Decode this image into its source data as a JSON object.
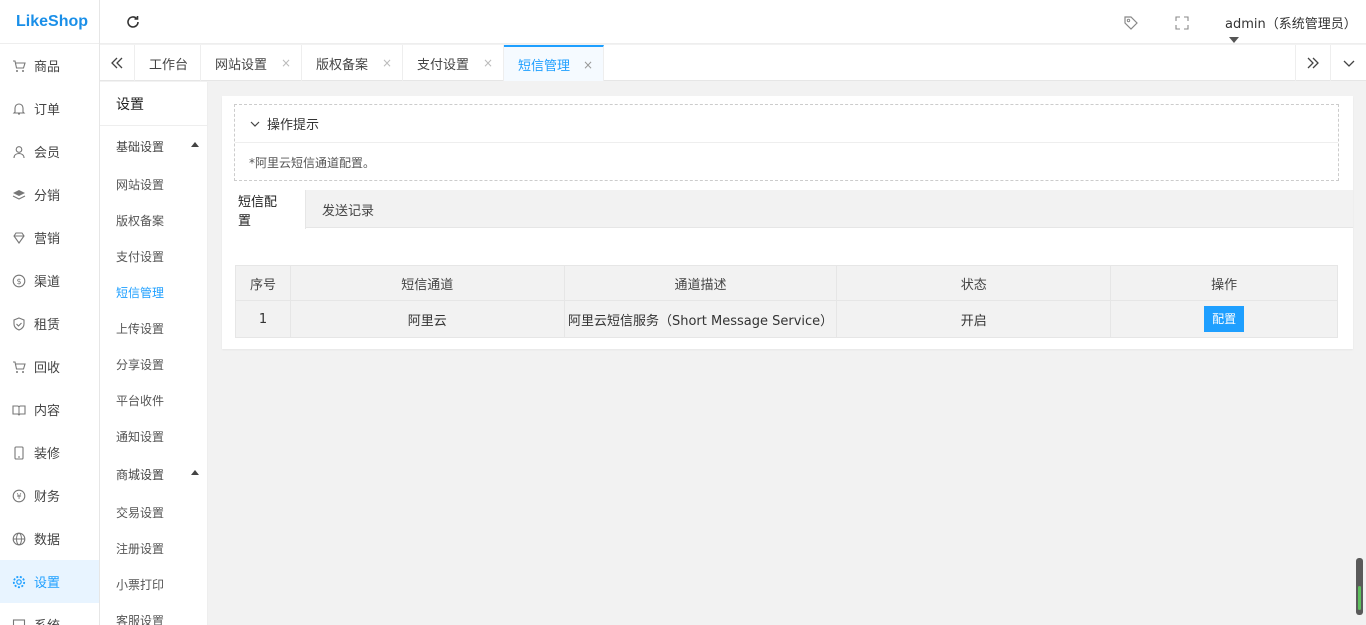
{
  "brand": "LikeShop",
  "user": {
    "label": "admin（系统管理员）"
  },
  "main_nav": [
    {
      "label": "商品",
      "icon": "cart-icon"
    },
    {
      "label": "订单",
      "icon": "bell-icon"
    },
    {
      "label": "会员",
      "icon": "user-icon"
    },
    {
      "label": "分销",
      "icon": "layers-icon"
    },
    {
      "label": "营销",
      "icon": "diamond-icon"
    },
    {
      "label": "渠道",
      "icon": "dollar-icon"
    },
    {
      "label": "租赁",
      "icon": "shield-icon"
    },
    {
      "label": "回收",
      "icon": "cart-icon"
    },
    {
      "label": "内容",
      "icon": "book-icon"
    },
    {
      "label": "装修",
      "icon": "phone-icon"
    },
    {
      "label": "财务",
      "icon": "yen-icon"
    },
    {
      "label": "数据",
      "icon": "globe-icon"
    },
    {
      "label": "设置",
      "icon": "gear-icon"
    },
    {
      "label": "系统",
      "icon": "system-icon"
    }
  ],
  "tabs": [
    {
      "label": "工作台"
    },
    {
      "label": "网站设置"
    },
    {
      "label": "版权备案"
    },
    {
      "label": "支付设置"
    },
    {
      "label": "短信管理"
    }
  ],
  "tab_close": "×",
  "sub_menu": {
    "title": "设置",
    "group1": "基础设置",
    "items1": [
      "网站设置",
      "版权备案",
      "支付设置",
      "短信管理",
      "上传设置",
      "分享设置",
      "平台收件",
      "通知设置"
    ],
    "group2": "商城设置",
    "items2": [
      "交易设置",
      "注册设置",
      "小票打印",
      "客服设置"
    ]
  },
  "tips": {
    "title": "操作提示",
    "text": "*阿里云短信通道配置。"
  },
  "panel_tabs": [
    "短信配置",
    "发送记录"
  ],
  "table": {
    "headers": [
      "序号",
      "短信通道",
      "通道描述",
      "状态",
      "操作"
    ],
    "rows": [
      {
        "index": "1",
        "channel": "阿里云",
        "desc": "阿里云短信服务（Short Message Service）",
        "status": "开启",
        "action": "配置"
      }
    ]
  },
  "colors": {
    "accent": "#1e9fff",
    "brand": "#1a8fe8"
  }
}
